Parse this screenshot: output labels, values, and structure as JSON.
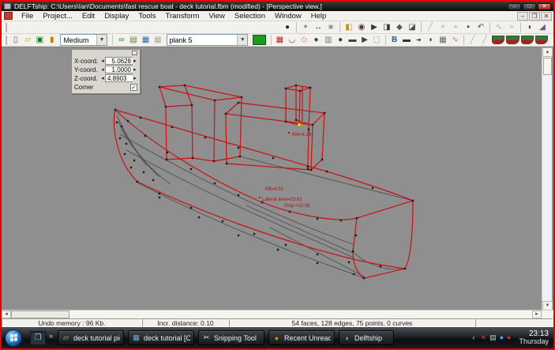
{
  "window": {
    "title": "DELFTship: C:\\Users\\Ian\\Documents\\fast rescue boat - deck tutorial.fbm (modified) - [Perspective view.]"
  },
  "menu": {
    "items": [
      {
        "label": "File"
      },
      {
        "label": "Project..."
      },
      {
        "label": "Edit"
      },
      {
        "label": "Display"
      },
      {
        "label": "Tools"
      },
      {
        "label": "Transform"
      },
      {
        "label": "View"
      },
      {
        "label": "Selection"
      },
      {
        "label": "Window"
      },
      {
        "label": "Help"
      }
    ]
  },
  "toolbar": {
    "precision_dropdown": "Medium",
    "layer_dropdown": "plank 5",
    "layer_color": "#1d9b1f"
  },
  "coord_panel": {
    "x_label": "X-coord.",
    "x_value": "5.0628",
    "y_label": "Y-coord.",
    "y_value": "1.0000",
    "z_label": "Z-coord.",
    "z_value": "4.8903",
    "corner_label": "Corner",
    "corner_checked": "✓"
  },
  "viewport": {
    "background_color": "#8f8f8f",
    "wireframe_color": "#cc1111",
    "annotations": [
      {
        "text": "KM=4.23"
      },
      {
        "text": "KB=0.51"
      },
      {
        "text": "Lateral area=23.61"
      },
      {
        "text": "Disp.=10.36"
      }
    ]
  },
  "statusbar": {
    "undo_memory": "Undo memory : 96 Kb.",
    "incr_distance": "Incr. distance: 0.10",
    "model_stats": "54 faces, 128 edges, 75 points, 0 curves"
  },
  "taskbar": {
    "buttons": [
      {
        "label": "deck tutorial pics"
      },
      {
        "label": "deck tutorial [Comp..."
      },
      {
        "label": "Snipping Tool"
      },
      {
        "label": "Recent Unread Topi..."
      },
      {
        "label": "Delftship"
      }
    ],
    "clock": {
      "time": "23:13",
      "day": "Thursday"
    }
  },
  "icons": {
    "minimize": "–",
    "maximize": "□",
    "close": "✕",
    "mdi_minimize": "–",
    "mdi_restore": "❐",
    "mdi_close": "✕",
    "new_file": "▯",
    "open_folder": "▱",
    "save": "▣",
    "export_doc": "▮",
    "dropdown_arrow": "▼",
    "visibility_glasses": "∞",
    "layers": "▤",
    "shade_net": "▦",
    "wireframe_off": "▦",
    "net_grid": "▦",
    "curve": "◡",
    "crease_diamond": "◇",
    "point_sphere": "●",
    "grid_lines": "▥",
    "dark_sphere": "●",
    "cylinder": "▬",
    "cone": "▶",
    "plane_off": "▢",
    "insert_plane": "B",
    "solid_block": "▬",
    "point_arrow": "➔",
    "blob": "◗",
    "deck_grid": "▦",
    "flowline": "∿",
    "slash_off": "╱",
    "world": "●",
    "pan_cross": "+",
    "measure": "↔",
    "box_gray": "■",
    "scale": "◧",
    "rotate": "◉",
    "move_arrow": "▶",
    "mirror": "◨",
    "align": "◆",
    "project": "◪",
    "line": "╱",
    "add_point": "+",
    "window_new": "▫",
    "window_fill": "▪",
    "undo_curl": "↶",
    "curve_wave": "∿",
    "curve_arrow": "≈",
    "kite": "◗",
    "swoosh": "◢",
    "scroll_up": "▲",
    "scroll_down": "▼",
    "scroll_left": "◄",
    "scroll_right": "►",
    "spin_left": "◂",
    "spin_right": "▸",
    "chevron_more": "»",
    "tray_collapse": "‹",
    "folder": "▱",
    "image_doc": "▦",
    "scissors": "✂",
    "firefox": "●",
    "delftship_boat": "◗",
    "tray_red": "✕",
    "tray_gray": "▤",
    "tray_blue": "●",
    "tray_dot": "●",
    "quick_launch": "❐"
  }
}
